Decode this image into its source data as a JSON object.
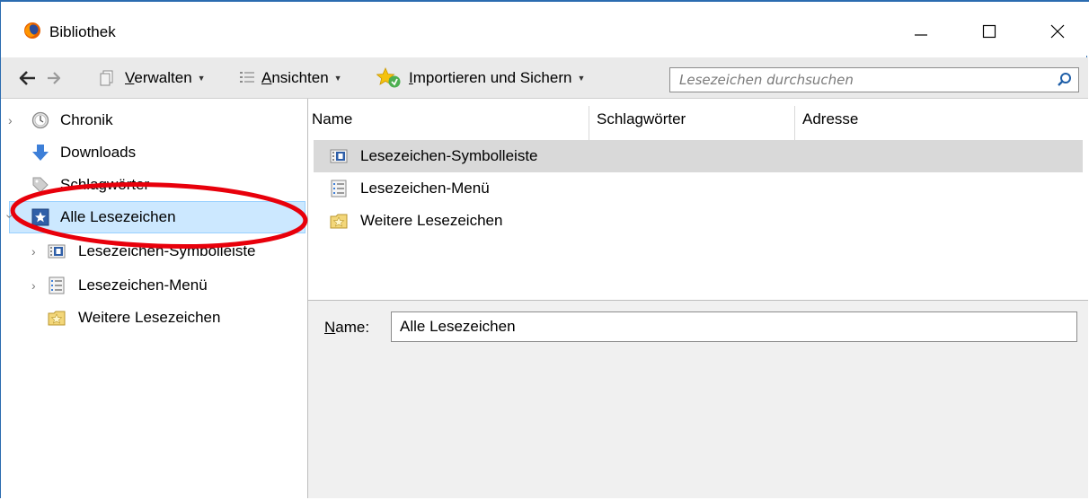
{
  "window": {
    "title": "Bibliothek"
  },
  "toolbar": {
    "manage_accel": "V",
    "manage_rest": "erwalten",
    "views_accel": "A",
    "views_rest": "nsichten",
    "import_accel": "I",
    "import_rest": "mportieren und Sichern",
    "search_placeholder": "Lesezeichen durchsuchen"
  },
  "sidebar": {
    "items": [
      {
        "label": "Chronik",
        "icon": "clock-icon"
      },
      {
        "label": "Downloads",
        "icon": "download-arrow-icon"
      },
      {
        "label": "Schlagwörter",
        "icon": "tag-icon"
      },
      {
        "label": "Alle Lesezeichen",
        "icon": "bookmark-star-icon",
        "selected": true
      },
      {
        "label": "Lesezeichen-Symbolleiste",
        "icon": "bookmarks-toolbar-icon"
      },
      {
        "label": "Lesezeichen-Menü",
        "icon": "bookmarks-menu-icon"
      },
      {
        "label": "Weitere Lesezeichen",
        "icon": "folder-star-icon"
      }
    ]
  },
  "list": {
    "columns": [
      "Name",
      "Schlagwörter",
      "Adresse"
    ],
    "rows": [
      {
        "label": "Lesezeichen-Symbolleiste",
        "icon": "bookmarks-toolbar-icon"
      },
      {
        "label": "Lesezeichen-Menü",
        "icon": "bookmarks-menu-icon"
      },
      {
        "label": "Weitere Lesezeichen",
        "icon": "folder-star-icon"
      }
    ]
  },
  "details": {
    "name_accel": "N",
    "name_rest": "ame:",
    "name_value": "Alle Lesezeichen"
  },
  "colors": {
    "selection": "#cce8ff",
    "highlight_row": "#d9d9d9",
    "annotation": "#e8000b",
    "window_border": "#2b6cb0"
  }
}
